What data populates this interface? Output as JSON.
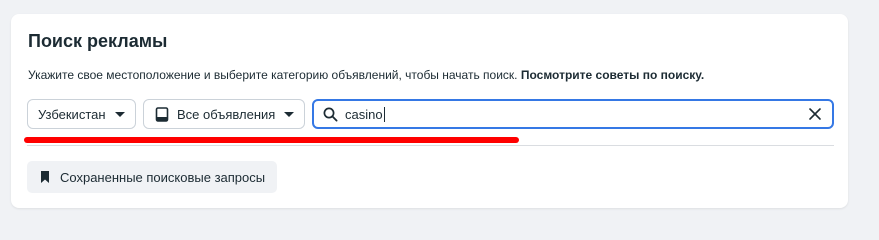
{
  "panel": {
    "title": "Поиск рекламы",
    "subtitle_text": "Укажите свое местоположение и выберите категорию объявлений, чтобы начать поиск. ",
    "tips_link": "Посмотрите советы по поиску."
  },
  "filters": {
    "country": {
      "value": "Узбекистан",
      "icon": "chevron-down-icon"
    },
    "category": {
      "value": "Все объявления",
      "icon": "tablet-icon"
    },
    "search": {
      "value": "casino",
      "icon": "search-icon",
      "clear_icon": "close-icon"
    }
  },
  "saved_searches": {
    "label": "Сохраненные поисковые запросы",
    "icon": "bookmark-icon"
  },
  "colors": {
    "accent": "#3578e5",
    "highlight": "#ff0000",
    "text": "#1c2b33"
  }
}
